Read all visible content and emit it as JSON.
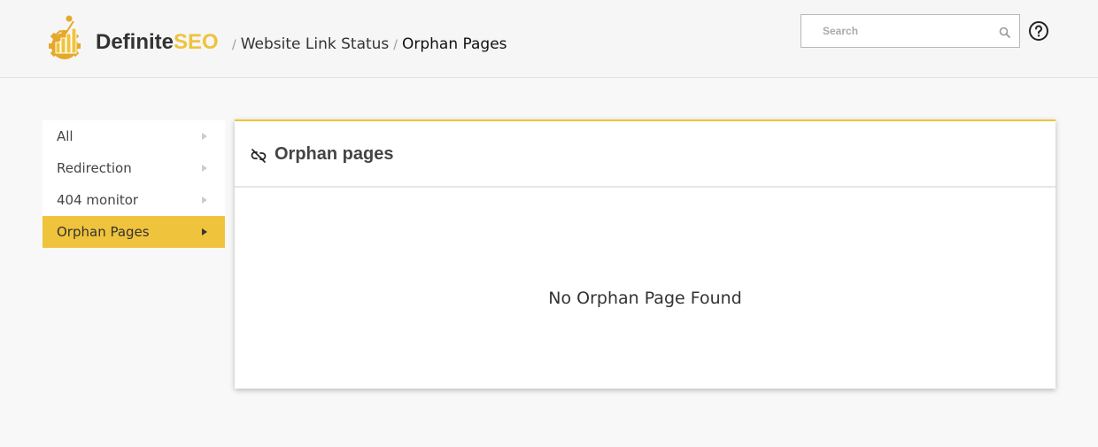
{
  "header": {
    "brand_part1": "Definite",
    "brand_part2": "SEO",
    "breadcrumb": [
      {
        "label": "Website Link Status"
      },
      {
        "label": "Orphan Pages"
      }
    ],
    "breadcrumb_separator": "/",
    "search": {
      "placeholder": "Search",
      "value": ""
    },
    "icons": {
      "logo": "gear-chart-logo-icon",
      "search": "search-icon",
      "help": "help-circle-icon"
    }
  },
  "sidebar": {
    "items": [
      {
        "label": "All",
        "active": false
      },
      {
        "label": "Redirection",
        "active": false
      },
      {
        "label": "404 monitor",
        "active": false
      },
      {
        "label": "Orphan Pages",
        "active": true
      }
    ]
  },
  "panel": {
    "title": "Orphan pages",
    "title_icon": "broken-link-icon",
    "empty_message": "No Orphan Page Found"
  },
  "colors": {
    "accent": "#f0c33c",
    "text": "#333333",
    "background": "#f8f8f8"
  }
}
